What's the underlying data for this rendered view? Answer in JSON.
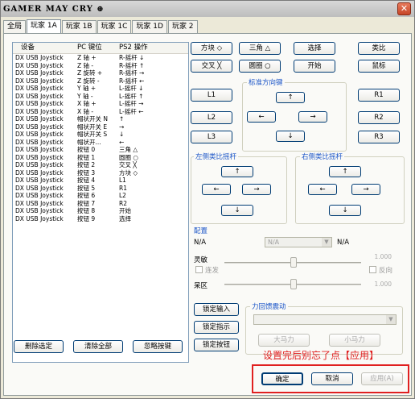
{
  "window": {
    "title": "GAMER MAY CRY ⊕"
  },
  "tabs": [
    "全局",
    "玩家 1A",
    "玩家 1B",
    "玩家 1C",
    "玩家 1D",
    "玩家 2"
  ],
  "list": {
    "headers": [
      "设备",
      "PC 键位",
      "PS2 操作"
    ],
    "rows": [
      [
        "DX USB Joystick",
        "Z 轴 +",
        "R-摇杆 ↓"
      ],
      [
        "DX USB Joystick",
        "Z 轴 -",
        "R-摇杆 ↑"
      ],
      [
        "DX USB Joystick",
        "Z 旋转 +",
        "R-摇杆 →"
      ],
      [
        "DX USB Joystick",
        "Z 旋转 -",
        "R-摇杆 ←"
      ],
      [
        "DX USB Joystick",
        "Y 轴 +",
        "L-摇杆 ↓"
      ],
      [
        "DX USB Joystick",
        "Y 轴 -",
        "L-摇杆 ↑"
      ],
      [
        "DX USB Joystick",
        "X 轴 +",
        "L-摇杆 →"
      ],
      [
        "DX USB Joystick",
        "X 轴 -",
        "L-摇杆 ←"
      ],
      [
        "DX USB Joystick",
        "帽状开关 N",
        "↑"
      ],
      [
        "DX USB Joystick",
        "帽状开关 E",
        "→"
      ],
      [
        "DX USB Joystick",
        "帽状开关 S",
        "↓"
      ],
      [
        "DX USB Joystick",
        "帽状开...",
        "←"
      ],
      [
        "DX USB Joystick",
        "按钮 0",
        "三角 △"
      ],
      [
        "DX USB Joystick",
        "按钮 1",
        "圆圈 ○"
      ],
      [
        "DX USB Joystick",
        "按钮 2",
        "交叉 ╳"
      ],
      [
        "DX USB Joystick",
        "按钮 3",
        "方块 ◇"
      ],
      [
        "DX USB Joystick",
        "按钮 4",
        "L1"
      ],
      [
        "DX USB Joystick",
        "按钮 5",
        "R1"
      ],
      [
        "DX USB Joystick",
        "按钮 6",
        "L2"
      ],
      [
        "DX USB Joystick",
        "按钮 7",
        "R2"
      ],
      [
        "DX USB Joystick",
        "按钮 8",
        "开始"
      ],
      [
        "DX USB Joystick",
        "按钮 9",
        "选择"
      ]
    ]
  },
  "buttons": {
    "square": "方块 ◇",
    "triangle": "三角 △",
    "select": "选择",
    "analog": "类比",
    "cross": "交叉 ╳",
    "circle": "圆圈 ○",
    "start": "开始",
    "mouse": "鼠标",
    "l1": "L1",
    "r1": "R1",
    "l2": "L2",
    "r2": "R2",
    "l3": "L3",
    "r3": "R3",
    "up": "↑",
    "down": "↓",
    "left": "←",
    "right": "→",
    "delete_selected": "删除选定",
    "clear_all": "清除全部",
    "ignore_keys": "忽略按键",
    "lock_input": "锁定输入",
    "lock_dir": "锁定指示",
    "lock_btn": "锁定按钮",
    "small_force": "大马力",
    "big_force": "小马力",
    "ok": "确定",
    "cancel": "取消",
    "apply": "应用(A)"
  },
  "groups": {
    "dpad": "标准方向键",
    "left_stick": "左侧类比摇杆",
    "right_stick": "右侧类比摇杆",
    "config": "配置",
    "force": "力回馈震动"
  },
  "config": {
    "left_value": "N/A",
    "select_value": "N/A",
    "right_value": "N/A",
    "sensitivity": "灵敏",
    "link": "连发",
    "reverse": "反向",
    "deadzone": "呆区",
    "sens_num": "1.000",
    "dead_num": "1.000"
  },
  "annotation": "设置完后别忘了点【应用】"
}
